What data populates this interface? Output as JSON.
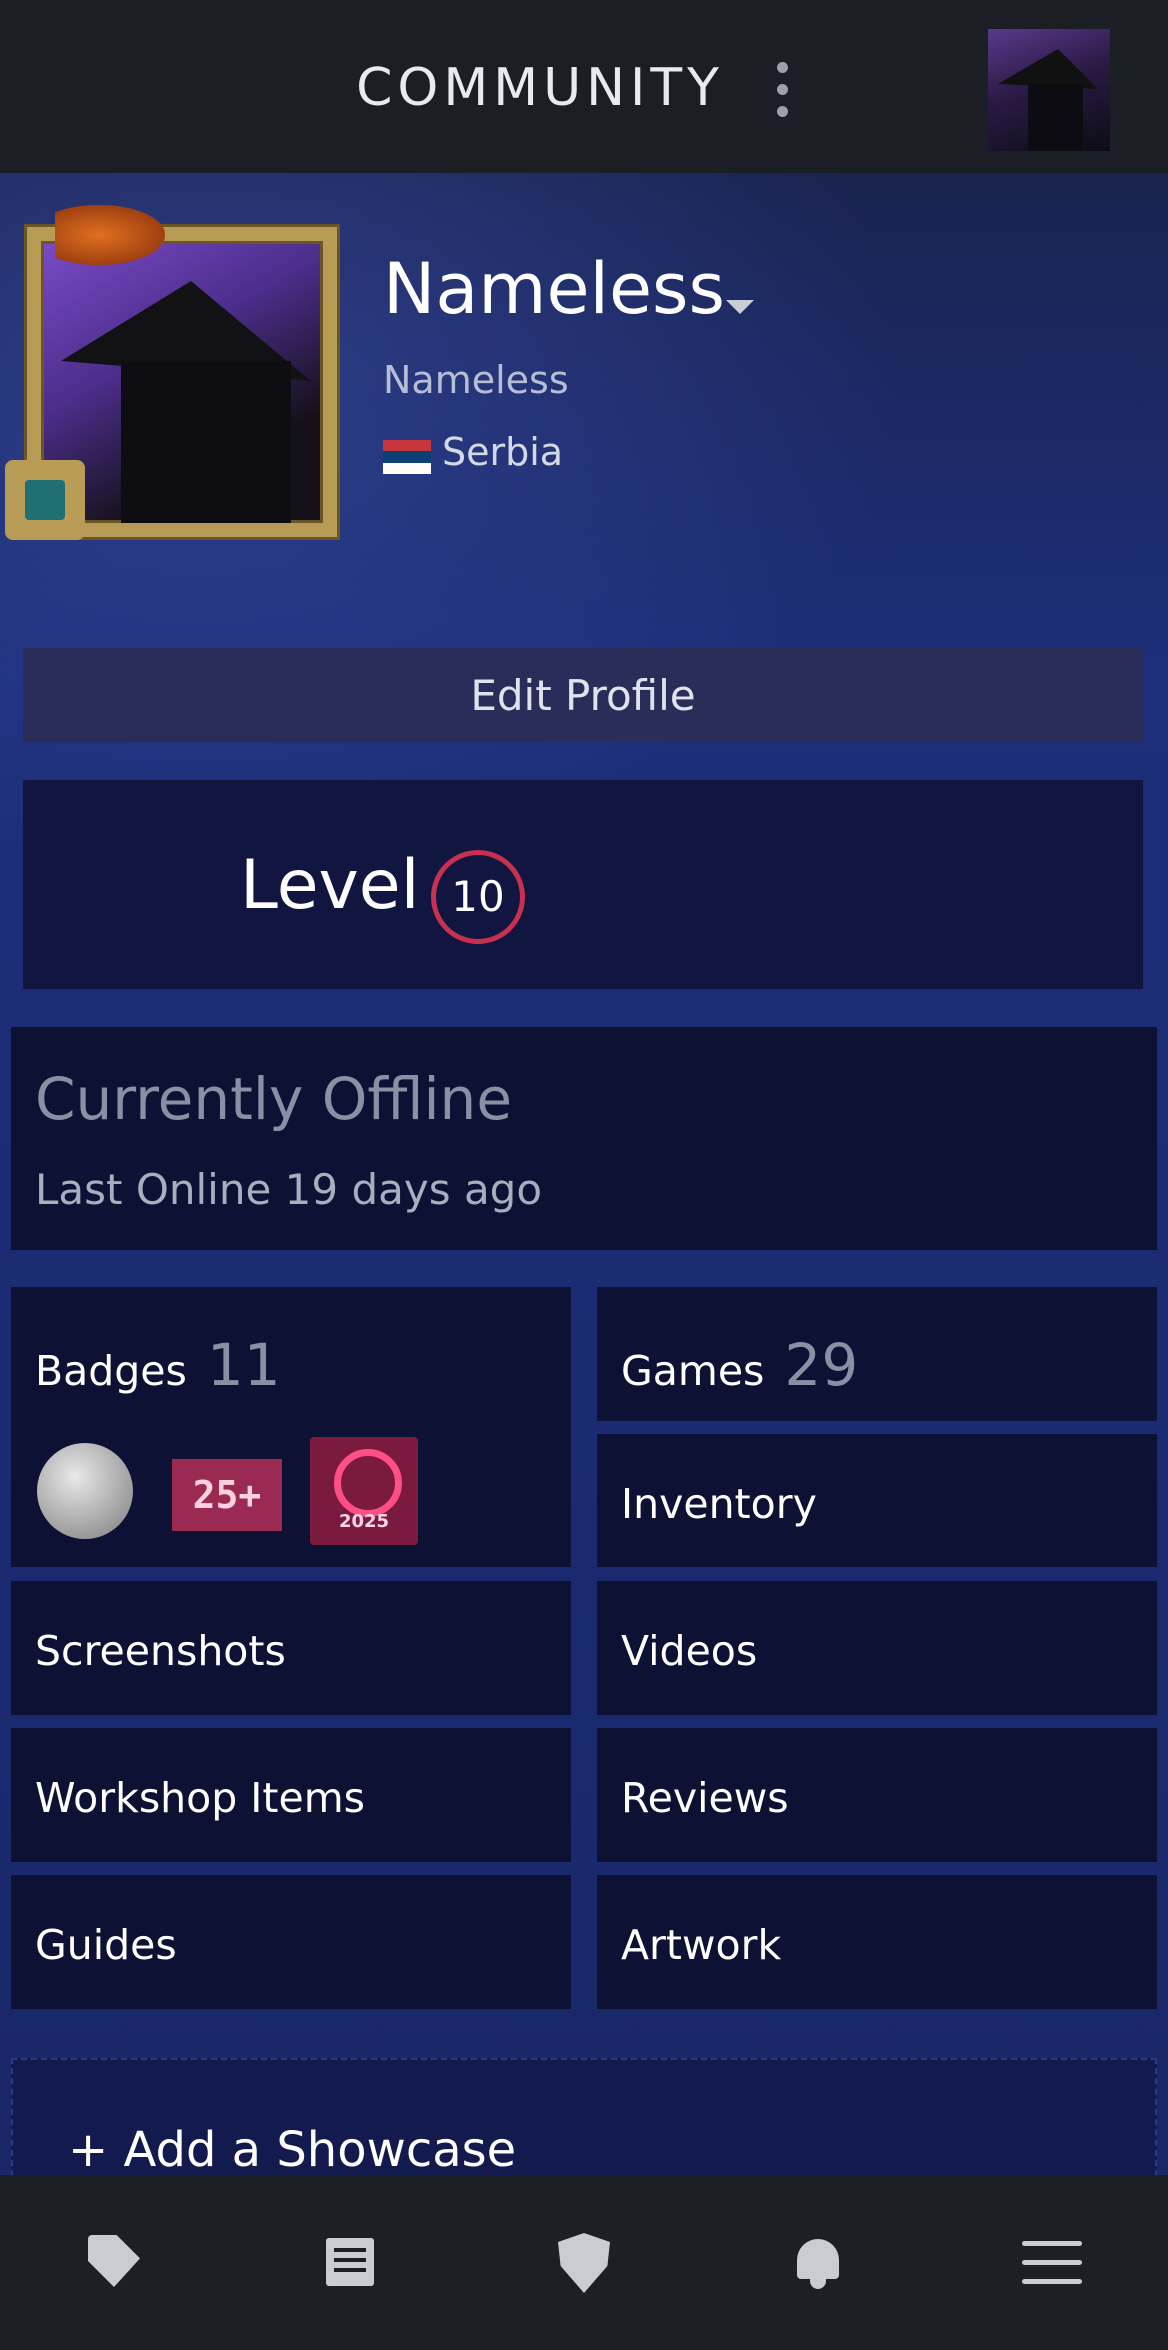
{
  "header": {
    "title": "COMMUNITY"
  },
  "profile": {
    "name": "Nameless",
    "real_name": "Nameless",
    "country": "Serbia",
    "edit_label": "Edit Profile",
    "level_label": "Level",
    "level": "10"
  },
  "status": {
    "state": "Currently Offline",
    "last_online": "Last Online 19 days ago"
  },
  "tiles": {
    "badges": {
      "label": "Badges",
      "count": "11"
    },
    "games": {
      "label": "Games",
      "count": "29"
    },
    "inventory": "Inventory",
    "screenshots": "Screenshots",
    "videos": "Videos",
    "workshop": "Workshop Items",
    "reviews": "Reviews",
    "guides": "Guides",
    "artwork": "Artwork"
  },
  "badge_icons": {
    "years": "25+",
    "year_badge": "2025"
  },
  "showcase": {
    "label": "+ Add a Showcase"
  },
  "bottom_nav": [
    "tag-icon",
    "news-icon",
    "shield-icon",
    "bell-icon",
    "menu-icon"
  ],
  "colors": {
    "level_ring": "#c8304f",
    "tile_bg": "#0d1133",
    "accent_blue": "#1d2f7a"
  }
}
